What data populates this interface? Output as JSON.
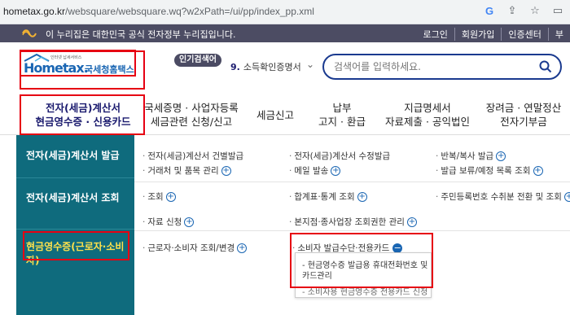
{
  "browser": {
    "url_host": "hometax.go.kr",
    "url_path": "/websquare/websquare.wq?w2xPath=/ui/pp/index_pp.xml",
    "icons": [
      "google-icon",
      "share-icon",
      "bookmark-star-icon",
      "window-icon"
    ]
  },
  "gov_banner": {
    "text": "이 누리집은 대한민국 공식 전자정부 누리집입니다.",
    "links": [
      "로그인",
      "회원가입",
      "인증센터",
      "부"
    ]
  },
  "logo": {
    "tiny_text": "인터넷 납세서비스",
    "main": "Hometax.",
    "sub": "국세청홈택스"
  },
  "popular": {
    "badge": "인기검색어",
    "rank": "9.",
    "keyword": "소득확인증명서"
  },
  "search": {
    "placeholder": "검색어를 입력하세요."
  },
  "nav": [
    {
      "line1": "전자(세금)계산서",
      "line2": "현금영수증 · 신용카드"
    },
    {
      "line1": "국세증명 · 사업자등록",
      "line2": "세금관련 신청/신고"
    },
    {
      "line1": "세금신고",
      "line2": ""
    },
    {
      "line1": "납부",
      "line2": "고지 · 환급"
    },
    {
      "line1": "지급명세서",
      "line2": "자료제출 · 공익법인"
    },
    {
      "line1": "장려금 · 연말정산",
      "line2": "전자기부금"
    }
  ],
  "rows": [
    {
      "title": "전자(세금)계산서 발급",
      "links": [
        "전자(세금)계산서 건별발급",
        "전자(세금)계산서 수정발급",
        "반복/복사 발급",
        "거래처 및 품목 관리",
        "메일 발송",
        "발급 보류/예정 목록 조회"
      ]
    },
    {
      "title": "전자(세금)계산서 조회",
      "links": [
        "조회",
        "합계표·통계 조회",
        "주민등록번호 수취분 전환 및 조회",
        "자료 신청",
        "본지점·종사업장 조회권한 관리"
      ]
    },
    {
      "title": "현금영수증(근로자·소비자)",
      "links": [
        "근로자·소비자 조회/변경",
        "소비자 발급수단·전용카드"
      ]
    }
  ],
  "submenu": {
    "item1": "현금영수증 발급용 휴대전화번호 및 카드관리",
    "item2": "소비자용 현금영수증 전용카드 신청"
  },
  "colors": {
    "left_column": "#0f6b7d",
    "highlight_red": "#e60012",
    "brand_blue": "#1a66b3",
    "banner": "#4c4c63"
  }
}
